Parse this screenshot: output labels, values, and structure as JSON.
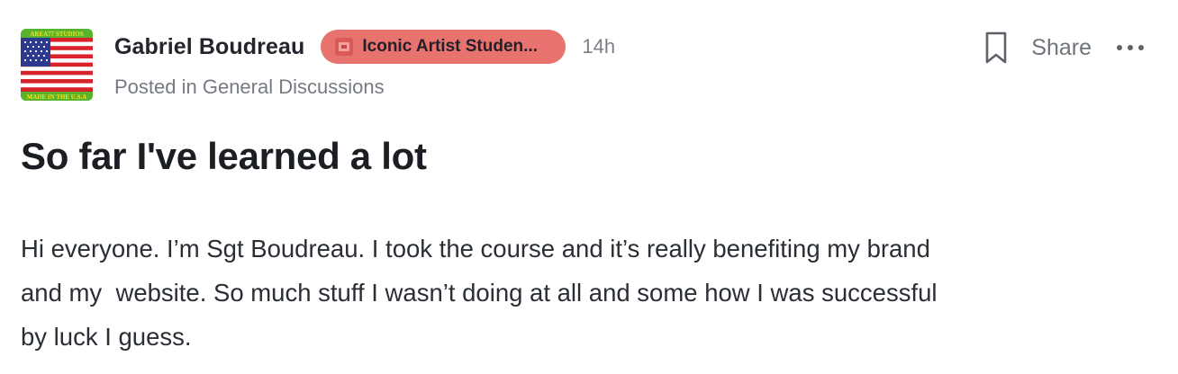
{
  "post": {
    "author": {
      "name": "Gabriel Boudreau",
      "avatar_alt": "flag-avatar",
      "avatar_texts": {
        "top": "AREA77 STUDIOS",
        "bottom": "MADE IN THE U.S.A"
      }
    },
    "badge": {
      "icon": "ticket-icon",
      "label": "Iconic Artist Studen...",
      "color": "#e8736e"
    },
    "time": "14h",
    "posted_in": "Posted in General Discussions",
    "actions": {
      "bookmark_icon": "bookmark-icon",
      "share_label": "Share",
      "more_icon": "more-horizontal-icon"
    },
    "title": "So far I've learned a lot",
    "body": "Hi everyone. I’m Sgt Boudreau. I took the course and it’s really benefiting my brand\nand my  website. So much stuff I wasn’t doing at all and some how I was successful\nby luck I guess."
  }
}
